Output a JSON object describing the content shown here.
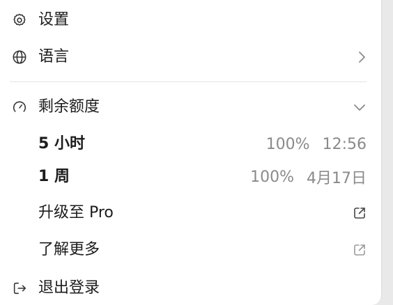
{
  "menu": {
    "settings": {
      "label": "设置",
      "icon": "gear-icon"
    },
    "language": {
      "label": "语言",
      "icon": "globe-icon"
    },
    "quota": {
      "label": "剩余额度",
      "icon": "gauge-icon",
      "limits": [
        {
          "label": "5 小时",
          "percent": "100%",
          "reset": "12:56"
        },
        {
          "label": "1 周",
          "percent": "100%",
          "reset": "4月17日"
        }
      ]
    },
    "upgrade": {
      "label": "升级至 Pro",
      "icon": "external-link-icon"
    },
    "learn_more": {
      "label": "了解更多",
      "icon": "external-link-icon"
    },
    "logout": {
      "label": "退出登录",
      "icon": "logout-icon"
    }
  }
}
